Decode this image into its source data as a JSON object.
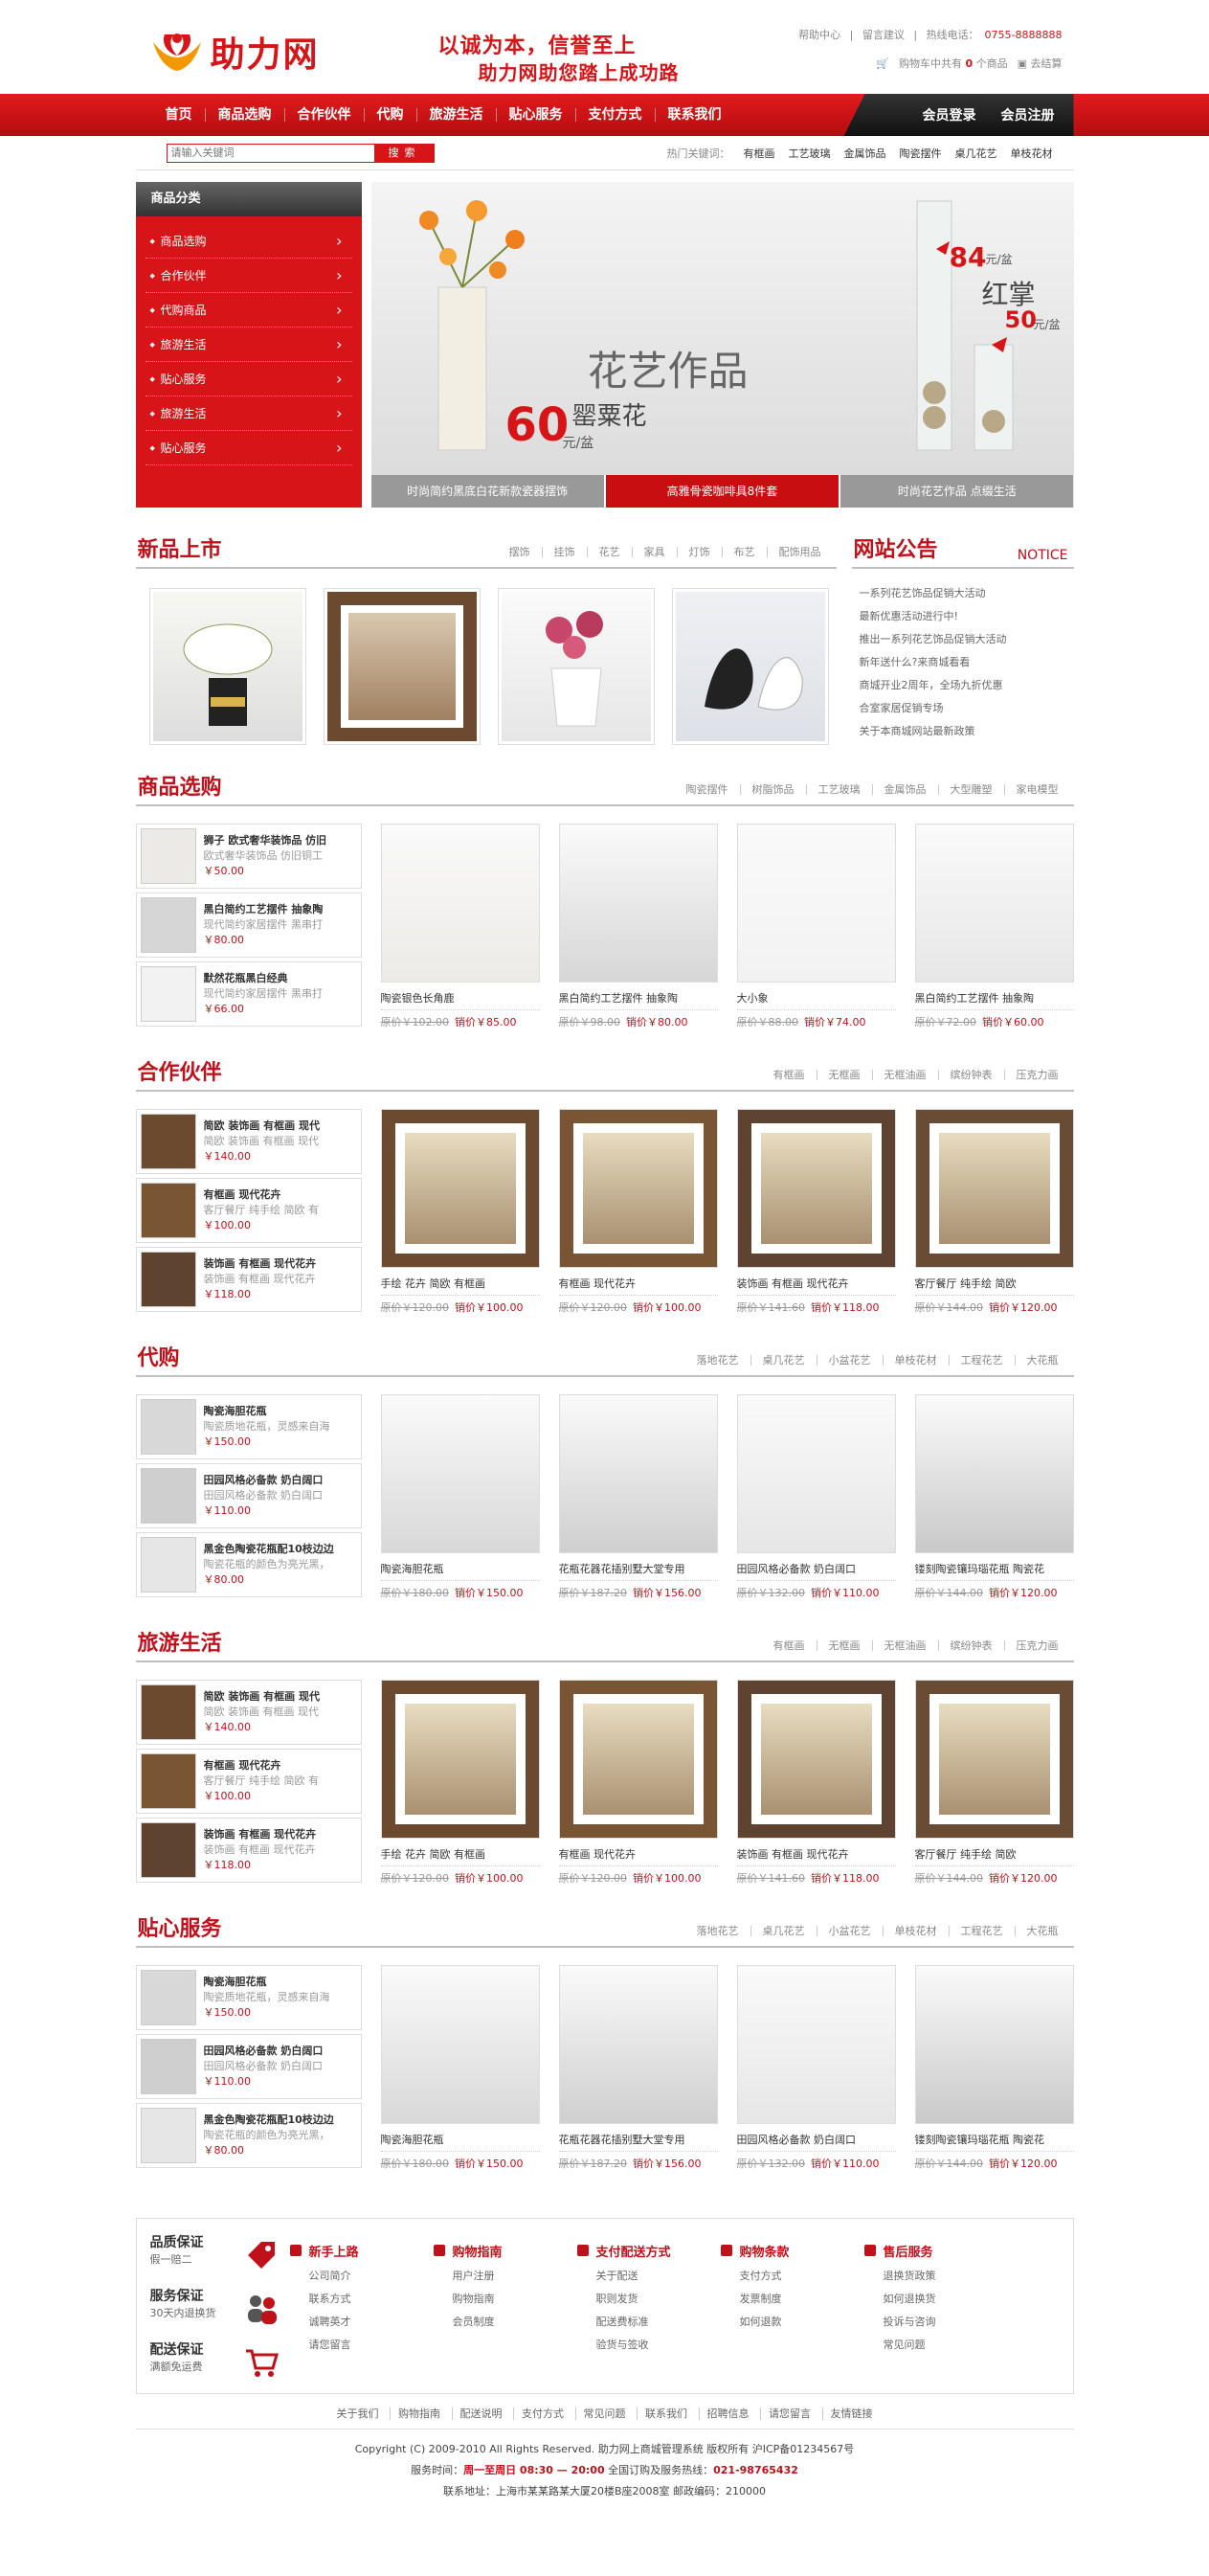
{
  "header": {
    "logo_text": "助力网",
    "slogan_line1": "以诚为本，信誉至上",
    "slogan_line2": "助力网助您踏上成功路",
    "toplinks": [
      "帮助中心",
      "留言建议",
      "热线电话："
    ],
    "phone": "0755-8888888",
    "cart_text_before": "购物车中共有",
    "cart_count": "0",
    "cart_text_after": "个商品",
    "checkout": "去结算"
  },
  "nav": {
    "items": [
      "首页",
      "商品选购",
      "合作伙伴",
      "代购",
      "旅游生活",
      "贴心服务",
      "支付方式",
      "联系我们"
    ],
    "login": "会员登录",
    "register": "会员注册"
  },
  "search": {
    "placeholder": "请输入关键词",
    "button": "搜索",
    "hot_label": "热门关键词：",
    "keywords": [
      "有框画",
      "工艺玻璃",
      "金属饰品",
      "陶瓷摆件",
      "桌几花艺",
      "单枝花材"
    ]
  },
  "categories": {
    "title": "商品分类",
    "items": [
      "商品选购",
      "合作伙伴",
      "代购商品",
      "旅游生活",
      "贴心服务",
      "旅游生活",
      "贴心服务"
    ]
  },
  "banner": {
    "title": "花艺作品",
    "flower": "罂粟花",
    "price1": "60",
    "unit": "元/盆",
    "price2": "84",
    "name2": "红掌",
    "price3": "50",
    "tabs": [
      "时尚简约黑底白花新款瓷器摆饰",
      "高雅骨瓷咖啡具8件套",
      "时尚花艺作品 点缀生活"
    ]
  },
  "new_products": {
    "title": "新品上市",
    "links": [
      "摆饰",
      "挂饰",
      "花艺",
      "家具",
      "灯饰",
      "布艺",
      "配饰用品"
    ]
  },
  "notice": {
    "title": "网站公告",
    "en": "NOTICE",
    "items": [
      "一系列花艺饰品促销大活动",
      "最新优惠活动进行中!",
      "推出一系列花艺饰品促销大活动",
      "新年送什么?来商城看看",
      "商城开业2周年，全场九折优惠",
      "合室家居促销专场",
      "关于本商城网站最新政策"
    ]
  },
  "sections": [
    {
      "title": "商品选购",
      "links": [
        "陶瓷摆件",
        "树脂饰品",
        "工艺玻璃",
        "金属饰品",
        "大型雕塑",
        "家电模型"
      ],
      "side": [
        {
          "name": "狮子 欧式奢华装饰品 仿旧",
          "desc": "欧式奢华装饰品 仿旧铜工",
          "price": "￥50.00"
        },
        {
          "name": "黑白简约工艺摆件 抽象陶",
          "desc": "现代简约家居摆件 黑串打",
          "price": "￥80.00"
        },
        {
          "name": "默然花瓶黑白经典",
          "desc": "现代简约家居摆件 黑串打",
          "price": "￥66.00"
        }
      ],
      "cards": [
        {
          "name": "陶瓷银色长角鹿",
          "orig": "原价￥102.00",
          "sale": "销价￥85.00"
        },
        {
          "name": "黑白简约工艺摆件 抽象陶",
          "orig": "原价￥98.00",
          "sale": "销价￥80.00"
        },
        {
          "name": "大小象",
          "orig": "原价￥88.00",
          "sale": "销价￥74.00"
        },
        {
          "name": "黑白简约工艺摆件 抽象陶",
          "orig": "原价￥72.00",
          "sale": "销价￥60.00"
        }
      ]
    },
    {
      "title": "合作伙伴",
      "links": [
        "有框画",
        "无框画",
        "无框油画",
        "缤纷钟表",
        "压克力画"
      ],
      "side": [
        {
          "name": "简欧 装饰画 有框画 现代",
          "desc": "简欧 装饰画 有框画 现代",
          "price": "￥140.00"
        },
        {
          "name": "有框画 现代花卉",
          "desc": "客厅餐厅 纯手绘 简欧 有",
          "price": "￥100.00"
        },
        {
          "name": "装饰画 有框画 现代花卉",
          "desc": "装饰画 有框画 现代花卉",
          "price": "￥118.00"
        }
      ],
      "cards": [
        {
          "name": "手绘 花卉 简欧 有框画",
          "orig": "原价￥120.00",
          "sale": "销价￥100.00"
        },
        {
          "name": "有框画 现代花卉",
          "orig": "原价￥120.00",
          "sale": "销价￥100.00"
        },
        {
          "name": "装饰画 有框画 现代花卉",
          "orig": "原价￥141.60",
          "sale": "销价￥118.00"
        },
        {
          "name": "客厅餐厅 纯手绘 简欧",
          "orig": "原价￥144.00",
          "sale": "销价￥120.00"
        }
      ]
    },
    {
      "title": "代购",
      "links": [
        "落地花艺",
        "桌几花艺",
        "小盆花艺",
        "单枝花材",
        "工程花艺",
        "大花瓶"
      ],
      "side": [
        {
          "name": "陶瓷海胆花瓶",
          "desc": "陶瓷质地花瓶，灵感来自海",
          "price": "￥150.00"
        },
        {
          "name": "田园风格必备款 奶白阔口",
          "desc": "田园风格必备款 奶白阔口",
          "price": "￥110.00"
        },
        {
          "name": "黑金色陶瓷花瓶配10枝边边",
          "desc": "陶瓷花瓶的颜色为亮光黑，",
          "price": "￥80.00"
        }
      ],
      "cards": [
        {
          "name": "陶瓷海胆花瓶",
          "orig": "原价￥180.00",
          "sale": "销价￥150.00"
        },
        {
          "name": "花瓶花器花插别墅大堂专用",
          "orig": "原价￥187.20",
          "sale": "销价￥156.00"
        },
        {
          "name": "田园风格必备款 奶白阔口",
          "orig": "原价￥132.00",
          "sale": "销价￥110.00"
        },
        {
          "name": "镂刻陶瓷镶玛瑙花瓶 陶瓷花",
          "orig": "原价￥144.00",
          "sale": "销价￥120.00"
        }
      ]
    },
    {
      "title": "旅游生活",
      "links": [
        "有框画",
        "无框画",
        "无框油画",
        "缤纷钟表",
        "压克力画"
      ],
      "side": [
        {
          "name": "简欧 装饰画 有框画 现代",
          "desc": "简欧 装饰画 有框画 现代",
          "price": "￥140.00"
        },
        {
          "name": "有框画 现代花卉",
          "desc": "客厅餐厅 纯手绘 简欧 有",
          "price": "￥100.00"
        },
        {
          "name": "装饰画 有框画 现代花卉",
          "desc": "装饰画 有框画 现代花卉",
          "price": "￥118.00"
        }
      ],
      "cards": [
        {
          "name": "手绘 花卉 简欧 有框画",
          "orig": "原价￥120.00",
          "sale": "销价￥100.00"
        },
        {
          "name": "有框画 现代花卉",
          "orig": "原价￥120.00",
          "sale": "销价￥100.00"
        },
        {
          "name": "装饰画 有框画 现代花卉",
          "orig": "原价￥141.60",
          "sale": "销价￥118.00"
        },
        {
          "name": "客厅餐厅 纯手绘 简欧",
          "orig": "原价￥144.00",
          "sale": "销价￥120.00"
        }
      ]
    },
    {
      "title": "贴心服务",
      "links": [
        "落地花艺",
        "桌几花艺",
        "小盆花艺",
        "单枝花材",
        "工程花艺",
        "大花瓶"
      ],
      "side": [
        {
          "name": "陶瓷海胆花瓶",
          "desc": "陶瓷质地花瓶，灵感来自海",
          "price": "￥150.00"
        },
        {
          "name": "田园风格必备款 奶白阔口",
          "desc": "田园风格必备款 奶白阔口",
          "price": "￥110.00"
        },
        {
          "name": "黑金色陶瓷花瓶配10枝边边",
          "desc": "陶瓷花瓶的颜色为亮光黑，",
          "price": "￥80.00"
        }
      ],
      "cards": [
        {
          "name": "陶瓷海胆花瓶",
          "orig": "原价￥180.00",
          "sale": "销价￥150.00"
        },
        {
          "name": "花瓶花器花插别墅大堂专用",
          "orig": "原价￥187.20",
          "sale": "销价￥156.00"
        },
        {
          "name": "田园风格必备款 奶白阔口",
          "orig": "原价￥132.00",
          "sale": "销价￥110.00"
        },
        {
          "name": "镂刻陶瓷镶玛瑙花瓶 陶瓷花",
          "orig": "原价￥144.00",
          "sale": "销价￥120.00"
        }
      ]
    }
  ],
  "footer": {
    "badges": [
      {
        "title": "品质保证",
        "sub": "假一赔二"
      },
      {
        "title": "服务保证",
        "sub": "30天内退换货"
      },
      {
        "title": "配送保证",
        "sub": "满额免运费"
      }
    ],
    "columns": [
      {
        "title": "新手上路",
        "items": [
          "公司简介",
          "联系方式",
          "诚聘英才",
          "请您留言"
        ]
      },
      {
        "title": "购物指南",
        "items": [
          "用户注册",
          "购物指南",
          "会员制度"
        ]
      },
      {
        "title": "支付配送方式",
        "items": [
          "关于配送",
          "职则发货",
          "配送费标准",
          "验货与签收"
        ]
      },
      {
        "title": "购物条款",
        "items": [
          "支付方式",
          "发票制度",
          "如何退款"
        ]
      },
      {
        "title": "售后服务",
        "items": [
          "退换货政策",
          "如何退换货",
          "投诉与咨询",
          "常见问题"
        ]
      }
    ],
    "links": [
      "关于我们",
      "购物指南",
      "配送说明",
      "支付方式",
      "常见问题",
      "联系我们",
      "招聘信息",
      "请您留言",
      "友情链接"
    ],
    "copyright": "Copyright (C) 2009-2010 All Rights Reserved.    助力网上商城管理系统 版权所有  沪ICP备01234567号",
    "service_label": "服务时间：",
    "service_time": "周一至周日 08:30 — 20:00",
    "hotline_label": "全国订购及服务热线：",
    "hotline": "021-98765432",
    "address": "联系地址：上海市某某路某大厦20楼B座2008室    邮政编码：210000"
  },
  "colors": {
    "brand": "#d71519",
    "dark": "#222222"
  }
}
